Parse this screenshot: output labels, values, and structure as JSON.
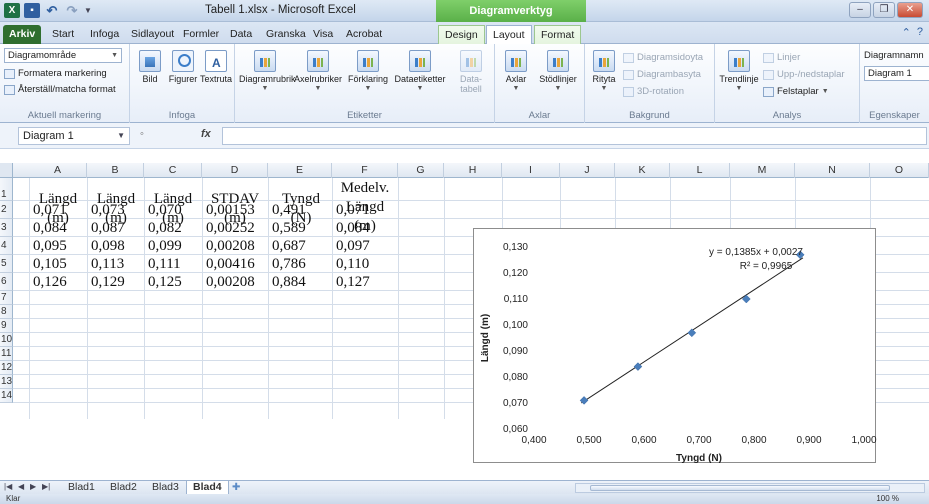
{
  "window": {
    "title": "Tabell 1.xlsx - Microsoft Excel",
    "context_header": "Diagramverktyg"
  },
  "tabs": [
    {
      "label": "Arkiv"
    },
    {
      "label": "Start"
    },
    {
      "label": "Infoga"
    },
    {
      "label": "Sidlayout"
    },
    {
      "label": "Formler"
    },
    {
      "label": "Data"
    },
    {
      "label": "Granska"
    },
    {
      "label": "Visa"
    },
    {
      "label": "Acrobat"
    },
    {
      "label": "Design"
    },
    {
      "label": "Layout"
    },
    {
      "label": "Format"
    }
  ],
  "ribbon": {
    "selection": {
      "dropdown": "Diagramområde",
      "format_selection": "Formatera markering",
      "reset_style": "Återställ/matcha format",
      "label": "Aktuell markering"
    },
    "insert": {
      "picture": "Bild",
      "shapes": "Figurer",
      "textbox": "Textruta",
      "label": "Infoga"
    },
    "labels": {
      "chart_title": "Diagramrubrik",
      "axis_titles": "Axelrubriker",
      "legend": "Förklaring",
      "data_labels": "Dataetiketter",
      "data_table": "Data-\ntabell",
      "label": "Etiketter"
    },
    "axes": {
      "axes": "Axlar",
      "gridlines": "Stödlinjer",
      "label": "Axlar"
    },
    "background": {
      "plot_area": "Rityta",
      "chart_wall": "Diagramsidoyta",
      "chart_floor": "Diagrambasyta",
      "rotation": "3D-rotation",
      "label": "Bakgrund"
    },
    "analysis": {
      "trendline": "Trendlinje",
      "lines": "Linjer",
      "updown_bars": "Upp-/nedstaplar",
      "error_bars": "Felstaplar",
      "label": "Analys"
    },
    "properties": {
      "chart_name_label": "Diagramnamn",
      "chart_name_value": "Diagram 1",
      "label": "Egenskaper"
    }
  },
  "formula_bar": {
    "name_box": "Diagram 1",
    "fx": "fx",
    "formula": ""
  },
  "columns": [
    "A",
    "B",
    "C",
    "D",
    "E",
    "F",
    "G",
    "H",
    "I",
    "J",
    "K",
    "L",
    "M",
    "N",
    "O"
  ],
  "rows": [
    "1",
    "2",
    "3",
    "4",
    "5",
    "6",
    "7",
    "8",
    "9",
    "10",
    "11",
    "12",
    "13",
    "14"
  ],
  "headers": {
    "a": [
      "Längd",
      "(m)"
    ],
    "b": [
      "Längd",
      "(m)"
    ],
    "c": [
      "Längd",
      "(m)"
    ],
    "d": [
      "STDAV",
      "(m)"
    ],
    "e": [
      "Tyngd",
      "(N)"
    ],
    "f": [
      "Medelv.",
      "Längd",
      "(m)"
    ]
  },
  "table": [
    [
      "0,071",
      "0,073",
      "0,070",
      "0,00153",
      "0,491",
      "0,071"
    ],
    [
      "0,084",
      "0,087",
      "0,082",
      "0,00252",
      "0,589",
      "0,084"
    ],
    [
      "0,095",
      "0,098",
      "0,099",
      "0,00208",
      "0,687",
      "0,097"
    ],
    [
      "0,105",
      "0,113",
      "0,111",
      "0,00416",
      "0,786",
      "0,110"
    ],
    [
      "0,126",
      "0,129",
      "0,125",
      "0,00208",
      "0,884",
      "0,127"
    ]
  ],
  "chart_data": {
    "type": "scatter",
    "title": "",
    "xlabel": "Tyngd (N)",
    "ylabel": "Längd (m)",
    "xlim": [
      0.4,
      1.0
    ],
    "ylim": [
      0.06,
      0.13
    ],
    "xticks": [
      "0,400",
      "0,500",
      "0,600",
      "0,700",
      "0,800",
      "0,900",
      "1,000"
    ],
    "yticks": [
      "0,060",
      "0,070",
      "0,080",
      "0,090",
      "0,100",
      "0,110",
      "0,120",
      "0,130"
    ],
    "x": [
      0.491,
      0.589,
      0.687,
      0.786,
      0.884
    ],
    "y": [
      0.071,
      0.084,
      0.097,
      0.11,
      0.127
    ],
    "trendline": {
      "slope": 0.1385,
      "intercept": 0.0027
    },
    "equation": "y = 0,1385x + 0,0027",
    "r2": "R² = 0,9965",
    "marker_color": "#4a7ebb",
    "grid": false
  },
  "sheets": [
    {
      "label": "Blad1"
    },
    {
      "label": "Blad2"
    },
    {
      "label": "Blad3"
    },
    {
      "label": "Blad4"
    }
  ],
  "status": {
    "text": "Klar",
    "zoom": "100 %"
  }
}
